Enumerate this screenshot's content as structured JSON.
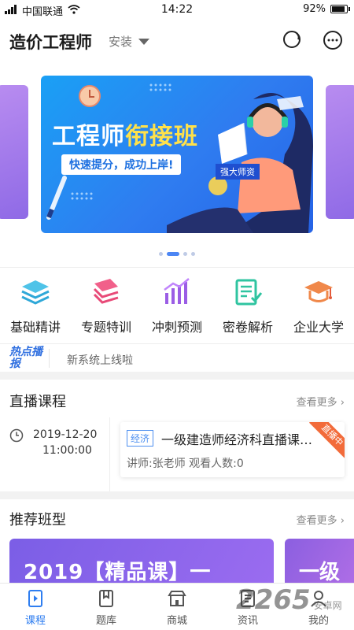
{
  "status_bar": {
    "carrier": "中国联通",
    "time": "14:22",
    "battery": "92%"
  },
  "header": {
    "title": "造价工程师",
    "install_label": "安装"
  },
  "banner": {
    "title_white": "工程师",
    "title_yellow": "衔接班",
    "tagline": "快速提分，成功上岸!",
    "teacher_badge": "强大师资",
    "active_slide_index": 2,
    "slide_count": 4
  },
  "categories": [
    {
      "label": "基础精讲",
      "icon": "layers-icon"
    },
    {
      "label": "专题特训",
      "icon": "book-stack-icon"
    },
    {
      "label": "冲刺预测",
      "icon": "bar-chart-icon"
    },
    {
      "label": "密卷解析",
      "icon": "checklist-icon"
    },
    {
      "label": "企业大学",
      "icon": "graduation-cap-icon"
    }
  ],
  "hot_news": {
    "tag": "热点播报",
    "text": "新系统上线啦"
  },
  "live_section": {
    "heading": "直播课程",
    "more": "查看更多",
    "item": {
      "date": "2019-12-20",
      "time": "11:00:00",
      "subject": "经济",
      "title": "一级建造师经济科直播课…",
      "meta": "讲师:张老师     观看人数:0",
      "ribbon": "直播中"
    }
  },
  "recommend_section": {
    "heading": "推荐班型",
    "more": "查看更多",
    "card1_text": "2019【精品课】一",
    "card2_text": "一级"
  },
  "tabs": [
    {
      "label": "课程",
      "icon": "play-book-icon",
      "active": true
    },
    {
      "label": "题库",
      "icon": "bookmark-book-icon",
      "active": false
    },
    {
      "label": "商城",
      "icon": "store-icon",
      "active": false
    },
    {
      "label": "资讯",
      "icon": "news-icon",
      "active": false
    },
    {
      "label": "我的",
      "icon": "user-icon",
      "active": false
    }
  ],
  "watermark": {
    "brand": "2265",
    "suffix": "安卓网"
  },
  "colors": {
    "accent": "#2f7ef0",
    "banner_blue": "#2f7cf0",
    "ribbon": "#f26b3a"
  }
}
